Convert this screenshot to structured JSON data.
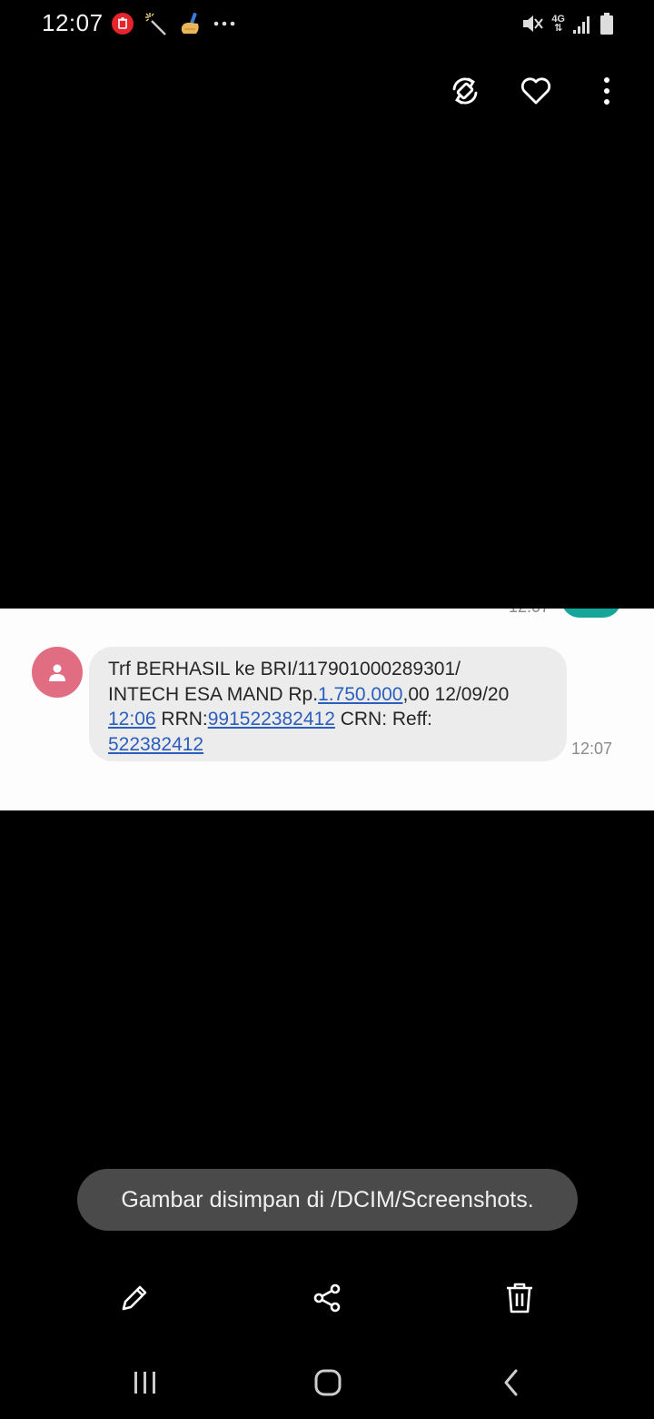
{
  "status_bar": {
    "time": "12:07",
    "network_type": "4G",
    "left_icons": [
      "delete-notification-icon",
      "magic-wand-icon",
      "cleaner-icon",
      "more-dots-icon"
    ],
    "right_icons": [
      "mute-vibrate-icon",
      "network-4g-icon",
      "signal-icon",
      "battery-icon"
    ]
  },
  "viewer_toolbar": {
    "icons": [
      "rotate-icon",
      "favorite-heart-icon",
      "more-options-icon"
    ]
  },
  "screenshot": {
    "previous_message_time": "12:07",
    "previous_bubble_color": "#16a59a",
    "avatar_color": "#e06d82",
    "message": {
      "l1": "Trf BERHASIL ke BRI/117901000289301/",
      "l2_pre": "INTECH ESA MAND Rp.",
      "l2_link": "1.750.000",
      "l2_post": ",00 12/09/20",
      "l3_link1": "12:06",
      "l3_mid": " RRN:",
      "l3_link2": "991522382412",
      "l3_post": " CRN: Reff:",
      "l4_link": "522382412"
    },
    "message_time": "12:07",
    "link_color": "#2b5ebd"
  },
  "toast": {
    "text": "Gambar disimpan di /DCIM/Screenshots."
  },
  "bottom_toolbar": {
    "icons": [
      "edit-pencil-icon",
      "share-icon",
      "delete-trash-icon"
    ]
  },
  "navigation_bar": {
    "icons": [
      "recent-apps-icon",
      "home-icon",
      "back-icon"
    ]
  }
}
